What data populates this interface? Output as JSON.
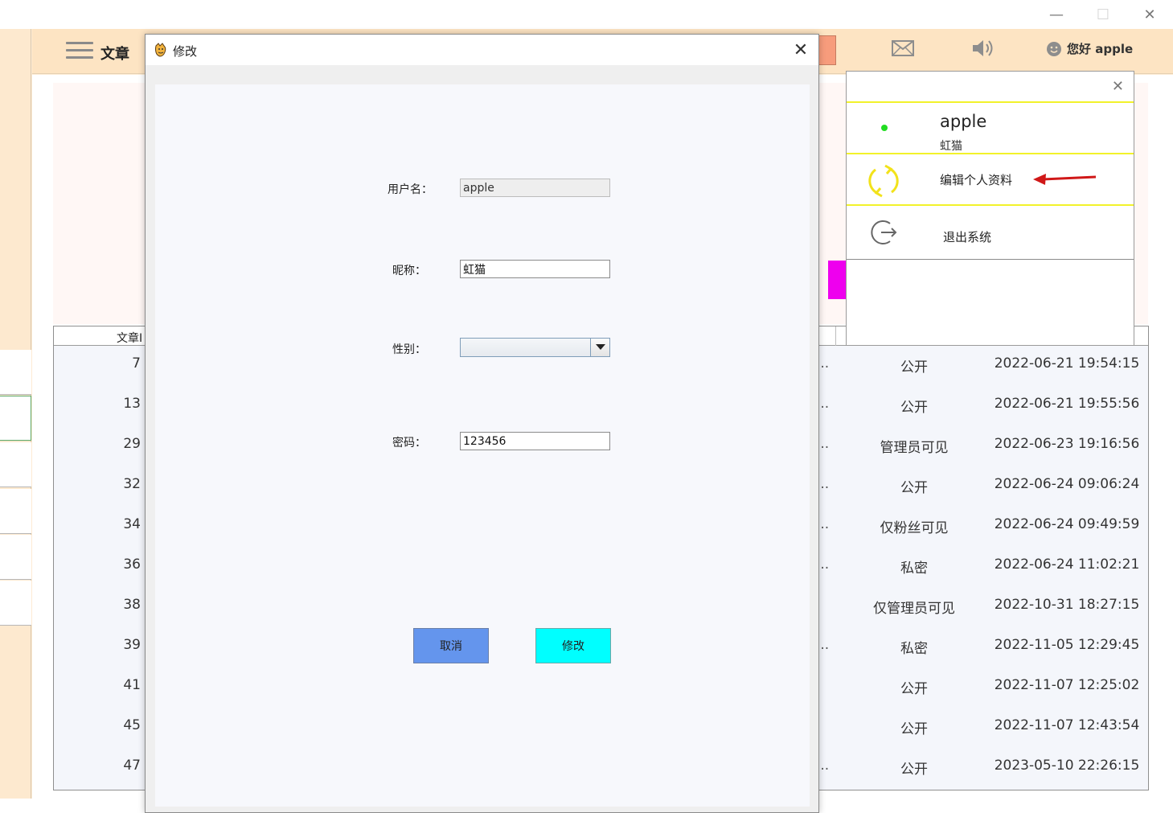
{
  "window": {
    "minimize": "—",
    "maximize": "☐",
    "close": "✕"
  },
  "topbar": {
    "title": "文章",
    "greeting": "您好 apple"
  },
  "table": {
    "header_id": "文章I",
    "rows": [
      {
        "id": "7",
        "trunc": "...",
        "visibility": "公开",
        "time": "2022-06-21 19:54:15"
      },
      {
        "id": "13",
        "trunc": "...",
        "visibility": "公开",
        "time": "2022-06-21 19:55:56"
      },
      {
        "id": "29",
        "trunc": "...",
        "visibility": "管理员可见",
        "time": "2022-06-23 19:16:56"
      },
      {
        "id": "32",
        "trunc": "...",
        "visibility": "公开",
        "time": "2022-06-24 09:06:24"
      },
      {
        "id": "34",
        "trunc": "...",
        "visibility": "仅粉丝可见",
        "time": "2022-06-24 09:49:59"
      },
      {
        "id": "36",
        "trunc": "...",
        "visibility": "私密",
        "time": "2022-06-24 11:02:21"
      },
      {
        "id": "38",
        "trunc": "",
        "visibility": "仅管理员可见",
        "time": "2022-10-31 18:27:15"
      },
      {
        "id": "39",
        "trunc": "...",
        "visibility": "私密",
        "time": "2022-11-05 12:29:45"
      },
      {
        "id": "41",
        "trunc": "",
        "visibility": "公开",
        "time": "2022-11-07 12:25:02"
      },
      {
        "id": "45",
        "trunc": "",
        "visibility": "公开",
        "time": "2022-11-07 12:43:54"
      },
      {
        "id": "47",
        "trunc": "...",
        "visibility": "公开",
        "time": "2023-05-10 22:26:15"
      }
    ]
  },
  "dialog": {
    "title": "修改",
    "close": "✕",
    "username_label": "用户名：",
    "username_value": "apple",
    "nickname_label": "昵称：",
    "nickname_value": "虹猫",
    "gender_label": "性别：",
    "gender_value": "",
    "password_label": "密码：",
    "password_value": "123456",
    "cancel_label": "取消",
    "submit_label": "修改"
  },
  "popup": {
    "close": "✕",
    "username": "apple",
    "nickname": "虹猫",
    "edit_profile": "编辑个人资料",
    "logout": "退出系统"
  },
  "colors": {
    "cancel_button": "#6495ed",
    "submit_button": "#00ffff",
    "accent_line": "#f2f22a",
    "online": "#22dd22"
  }
}
